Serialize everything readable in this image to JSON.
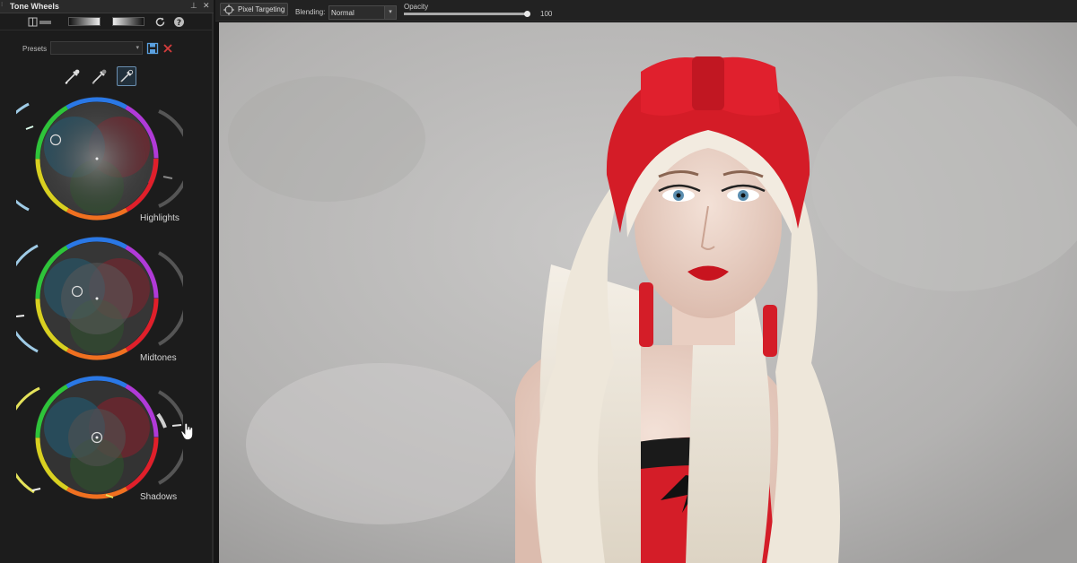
{
  "panel": {
    "title": "Tone Wheels",
    "pin_glyph": "⊥",
    "close_glyph": "✕",
    "toolbar_icons": [
      "levels-icon",
      "gradient-bw-icon",
      "gradient-wb-icon",
      "reset-icon",
      "help-icon"
    ],
    "presets_label": "Presets",
    "presets_value": "",
    "picker_tools": [
      "highlights-eyedropper-icon",
      "midtones-eyedropper-icon",
      "shadows-eyedropper-icon"
    ],
    "selected_picker": "shadows-eyedropper-icon"
  },
  "wheels": [
    {
      "label": "Highlights",
      "luminance": 0.68,
      "saturation": 0.55
    },
    {
      "label": "Midtones",
      "luminance": 0.42,
      "saturation": 0.15
    },
    {
      "label": "Shadows",
      "luminance": 0.22,
      "saturation": 0.28
    }
  ],
  "topbar": {
    "pixel_targeting_label": "Pixel Targeting",
    "blending_label": "Blending:",
    "blending_value": "Normal",
    "opacity_label": "Opacity",
    "opacity_value": "100",
    "opacity_fraction": 1.0
  },
  "colors": {
    "accent_blue": "#4f8fd8",
    "delete_red": "#d43c3c",
    "panel_bg": "#1c1c1c",
    "photo_wall": "#b9b8b7",
    "turban_red": "#d81e2a",
    "hair_platinum": "#efe9dd"
  }
}
